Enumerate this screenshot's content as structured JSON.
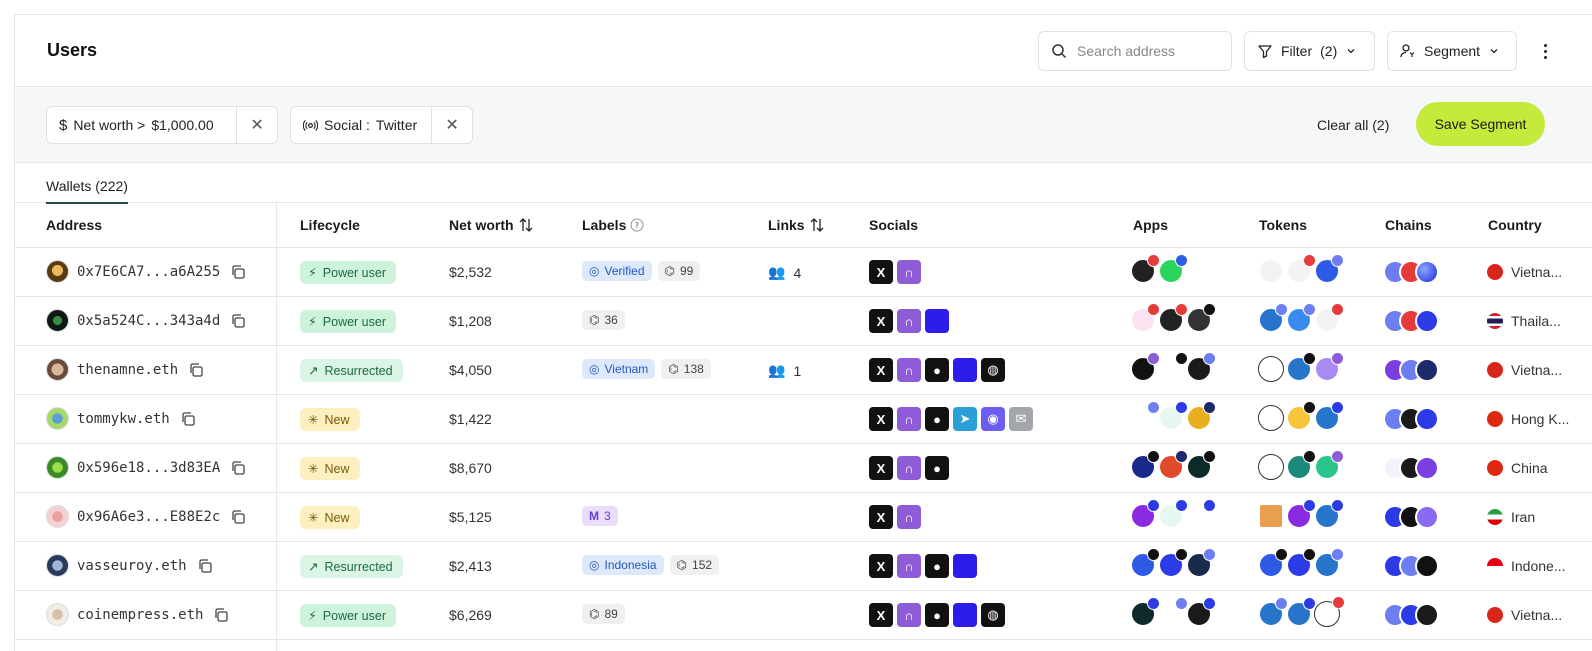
{
  "header": {
    "title": "Users",
    "search_placeholder": "Search address",
    "filter_label": "Filter",
    "filter_count": "(2)",
    "segment_label": "Segment"
  },
  "filters": {
    "chip1_prefix": "Net worth >",
    "chip1_value": "$1,000.00",
    "chip2_prefix": "Social :",
    "chip2_value": "Twitter",
    "clear_all": "Clear all (2)",
    "save_segment": "Save Segment"
  },
  "tabs": {
    "wallets": "Wallets (222)"
  },
  "columns": {
    "address": "Address",
    "lifecycle": "Lifecycle",
    "net_worth": "Net worth",
    "labels": "Labels",
    "links": "Links",
    "socials": "Socials",
    "apps": "Apps",
    "tokens": "Tokens",
    "chains": "Chains",
    "country": "Country"
  },
  "rows": [
    {
      "address": "0x7E6CA7...a6A255",
      "lifecycle": "Power user",
      "net_worth": "$2,532",
      "label_main": "Verified",
      "label_count": "99",
      "links": "4",
      "country": "Vietna..."
    },
    {
      "address": "0x5a524C...343a4d",
      "lifecycle": "Power user",
      "net_worth": "$1,208",
      "label_main": "",
      "label_count": "36",
      "links": "",
      "country": "Thaila..."
    },
    {
      "address": "thenamne.eth",
      "lifecycle": "Resurrected",
      "net_worth": "$4,050",
      "label_main": "Vietnam",
      "label_count": "138",
      "links": "1",
      "country": "Vietna..."
    },
    {
      "address": "tommykw.eth",
      "lifecycle": "New",
      "net_worth": "$1,422",
      "label_main": "",
      "label_count": "",
      "links": "",
      "country": "Hong K..."
    },
    {
      "address": "0x596e18...3d83EA",
      "lifecycle": "New",
      "net_worth": "$8,670",
      "label_main": "",
      "label_count": "",
      "links": "",
      "country": "China"
    },
    {
      "address": "0x96A6e3...E88E2c",
      "lifecycle": "New",
      "net_worth": "$5,125",
      "label_main": "",
      "label_count": "3",
      "links": "",
      "country": "Iran"
    },
    {
      "address": "vasseuroy.eth",
      "lifecycle": "Resurrected",
      "net_worth": "$2,413",
      "label_main": "Indonesia",
      "label_count": "152",
      "links": "",
      "country": "Indone..."
    },
    {
      "address": "coinempress.eth",
      "lifecycle": "Power user",
      "net_worth": "$6,269",
      "label_main": "",
      "label_count": "89",
      "links": "",
      "country": "Vietna..."
    }
  ],
  "icons": {
    "search": "search-icon",
    "filter": "filter-icon",
    "segment": "segment-icon",
    "chevron": "chevron-down-icon",
    "more": "more-vertical-icon",
    "close": "close-icon",
    "copy": "copy-icon",
    "sort": "sort-icon",
    "info": "info-icon",
    "users": "users-icon"
  },
  "colors": {
    "accent": "#c5ea3b",
    "power_user_bg": "#cdf3dc",
    "new_bg": "#fdf0c0",
    "label_blue_bg": "#dde9fb"
  }
}
